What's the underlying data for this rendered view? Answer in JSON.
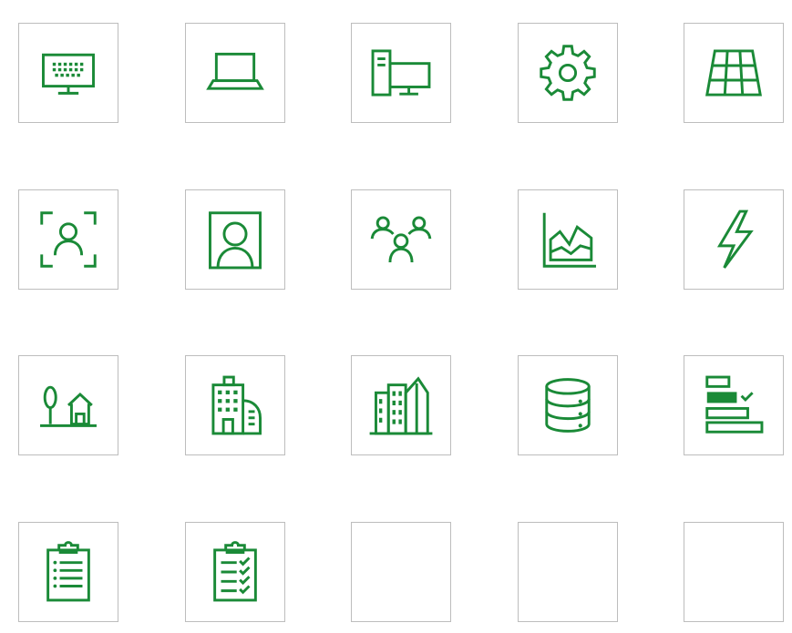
{
  "colors": {
    "accent": "#1a8a37",
    "tile_border": "#bdbdbd",
    "background": "#ffffff"
  },
  "icon_grid": {
    "tiles": [
      {
        "icon": "monitor-keyboard-icon"
      },
      {
        "icon": "laptop-icon"
      },
      {
        "icon": "desktop-computer-icon"
      },
      {
        "icon": "gear-icon"
      },
      {
        "icon": "solar-panel-icon"
      },
      {
        "icon": "face-scan-icon"
      },
      {
        "icon": "user-portrait-icon"
      },
      {
        "icon": "user-group-icon"
      },
      {
        "icon": "area-chart-icon"
      },
      {
        "icon": "lightning-bolt-icon"
      },
      {
        "icon": "tree-house-icon"
      },
      {
        "icon": "office-buildings-icon"
      },
      {
        "icon": "city-buildings-icon"
      },
      {
        "icon": "database-icon"
      },
      {
        "icon": "gantt-checklist-icon"
      },
      {
        "icon": "clipboard-list-icon"
      },
      {
        "icon": "clipboard-checklist-icon"
      },
      {
        "icon": "empty-tile"
      },
      {
        "icon": "empty-tile"
      },
      {
        "icon": "empty-tile"
      }
    ]
  }
}
